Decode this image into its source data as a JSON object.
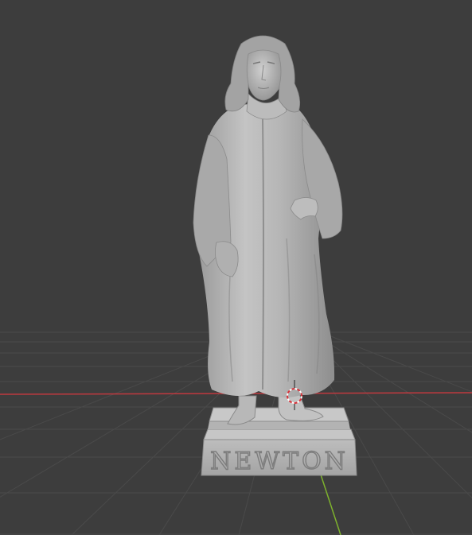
{
  "viewport": {
    "background": "#3d3d3d",
    "grid_color": "#4a4a4a",
    "x_axis_color": "#c0393f",
    "y_axis_color": "#7eb22d"
  },
  "model": {
    "name": "statue",
    "pedestal_text": "NEWTON",
    "material_color": "#b9b9b9"
  },
  "icons": {
    "cursor": "3d-cursor-icon"
  }
}
